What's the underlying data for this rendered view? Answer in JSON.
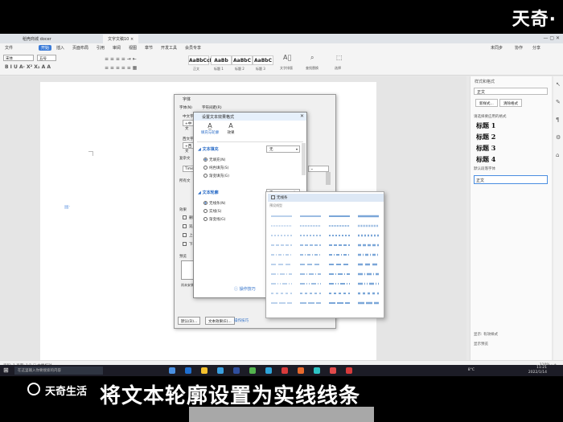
{
  "watermark": {
    "top": "天奇·",
    "bottom": "天奇生活"
  },
  "caption": "将文本轮廓设置为实线线条",
  "tabs": [
    {
      "label": "稻壳商城 docer"
    },
    {
      "label": "文字文稿10"
    }
  ],
  "menu": [
    "文件",
    "开始",
    "插入",
    "页面布局",
    "引用",
    "审阅",
    "视图",
    "章节",
    "开发工具",
    "会员专享"
  ],
  "ribbon": {
    "styles": [
      {
        "preview": "AaBbCcDd",
        "label": "正文"
      },
      {
        "preview": "AaBb",
        "label": "标题 1"
      },
      {
        "preview": "AaBbC",
        "label": "标题 2"
      },
      {
        "preview": "AaBbC",
        "label": "标题 3"
      }
    ],
    "right_items": [
      "文字排版",
      "查找替换",
      "选择"
    ],
    "font_name": "宋体",
    "font_size": "五号",
    "account": [
      "未同步",
      "协作",
      "分享"
    ]
  },
  "font_dialog": {
    "title": "字体",
    "tabs": [
      "字体(N)",
      "字符间距(R)"
    ],
    "labels": [
      "中文字",
      "西文字",
      "复杂文",
      "所有文",
      "效果",
      "预览"
    ],
    "fields": [
      "+中文",
      "+西文",
      "Times"
    ],
    "effects": [
      "删除",
      "双删",
      "上标",
      "下标"
    ],
    "note": "尚未安装此字体，打印时将采用最相近的有效字体。",
    "buttons": [
      "默认(D)...",
      "文本效果(E)...",
      "操作技巧"
    ]
  },
  "text_effect_dialog": {
    "title": "设置文本效果格式",
    "tabs": [
      {
        "label": "填充与轮廓",
        "icon": "fill-outline-icon"
      },
      {
        "label": "效果",
        "icon": "effect-icon"
      }
    ],
    "fill": {
      "section": "文本填充",
      "value": "无",
      "options": [
        "无填充(N)",
        "纯色填充(S)",
        "渐变填充(G)"
      ]
    },
    "outline": {
      "section": "文本轮廓",
      "value": "无",
      "options": [
        "无线条(N)",
        "实线(S)",
        "渐变线(G)"
      ]
    },
    "link": "操作技巧"
  },
  "dash_popup": {
    "none_label": "无线条",
    "label": "预设线型"
  },
  "right_panel": {
    "title": "样式和格式",
    "current_style": "正文",
    "buttons": [
      "新样式...",
      "清除格式"
    ],
    "subtitle": "请选择要应用的格式",
    "headings": [
      "标题 1",
      "标题 2",
      "标题 3",
      "标题 4"
    ],
    "default_font": "默认段落字体",
    "selected": "正文",
    "show": "显示: 有效样式",
    "preview": "显示预览"
  },
  "statusbar": {
    "left": "页码: 1  页面: 1/1",
    "center": "文档校对",
    "right": "110% -  +"
  },
  "taskbar": {
    "search": "在这里输入你要搜索的内容",
    "weather": "8°C",
    "time": "11:21",
    "date": "2022/1/14"
  }
}
